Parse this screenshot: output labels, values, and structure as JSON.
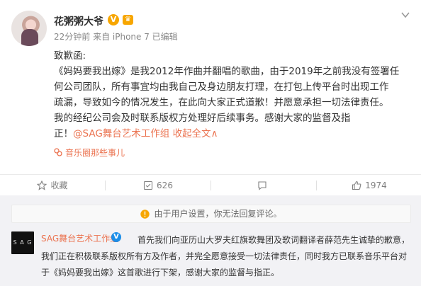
{
  "post": {
    "username": "花粥粥大爷",
    "meta": "22分钟前 来自 iPhone 7  已编辑",
    "body": {
      "greeting": "致歉函:",
      "line1": "《妈妈要我出嫁》是我2012年作曲并翻唱的歌曲，由于2019年之前我没有签署任",
      "line2": "何公司团队，所有事宜均由我自己及身边朋友打理，在打包上传平台时出现工作",
      "line3": "疏漏，导致如今的情况发生，在此向大家正式道歉！并愿意承担一切法律责任。",
      "line4": "我的经纪公司会及时联系版权方处理好后续事务。感谢大家的监督及指",
      "line5_prefix": "正！",
      "mention": "@SAG舞台艺术工作组",
      "collapse_link": "收起全文",
      "collapse_arrow": "∧"
    },
    "circle_tag": "音乐圈那些事儿"
  },
  "actions": {
    "favorite": "收藏",
    "repost": "626",
    "comment": "",
    "like": "1974"
  },
  "comments": {
    "notice": "由于用户设置，你无法回复评论。",
    "item": {
      "avatar_text": "S A G",
      "name": "SAG舞台艺术工作组",
      "text": "首先我们向亚历山大罗夫红旗歌舞团及歌词翻译者薛范先生诚挚的歉意，我们正在积极联系版权所有方及作者，并完全愿意接受一切法律责任，同时我方已联系音乐平台对于《妈妈要我出嫁》这首歌进行下架，感谢大家的监督与指正。"
    }
  },
  "colors": {
    "accent": "#eb7350",
    "verified_orange": "#f7a600",
    "verified_blue": "#1c8ee8"
  }
}
